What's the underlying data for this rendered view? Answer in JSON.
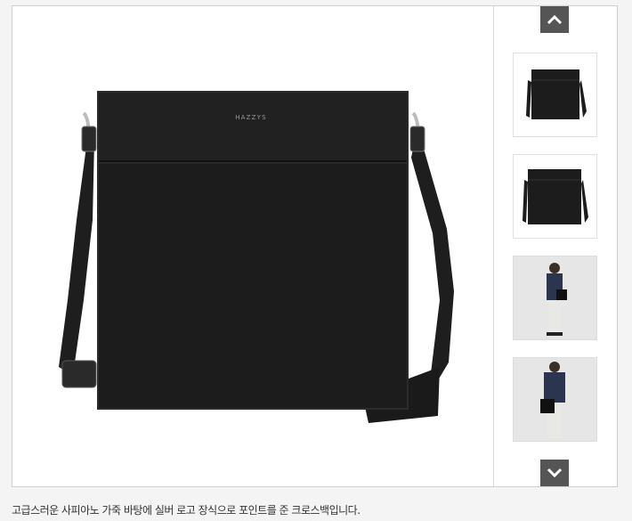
{
  "product": {
    "brand_logo_text": "HAZZYS",
    "description": "고급스러운 사피아노 가죽 바탕에 실버 로고 장식으로 포인트를 준 크로스백입니다."
  },
  "thumbnails": [
    {
      "name": "thumb-bag-front-strap"
    },
    {
      "name": "thumb-bag-front"
    },
    {
      "name": "thumb-model-side"
    },
    {
      "name": "thumb-model-front"
    }
  ],
  "colors": {
    "bag": "#1b1b1b",
    "nav_button": "#555555",
    "border": "#cfcfcf"
  }
}
